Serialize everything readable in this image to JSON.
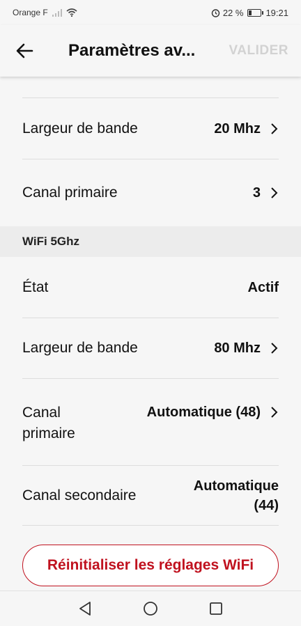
{
  "status": {
    "carrier": "Orange F",
    "battery": "22 %",
    "time": "19:21"
  },
  "app_bar": {
    "title": "Paramètres av...",
    "validate_label": "VALIDER"
  },
  "rows_top": [
    {
      "label": "Largeur de bande",
      "value": "20 Mhz"
    },
    {
      "label": "Canal primaire",
      "value": "3"
    }
  ],
  "section_5ghz": {
    "title": "WiFi 5Ghz"
  },
  "rows_5ghz": [
    {
      "label": "État",
      "value": "Actif"
    },
    {
      "label": "Largeur de bande",
      "value": "80 Mhz"
    },
    {
      "label": "Canal primaire",
      "value": "Automatique (48)"
    },
    {
      "label": "Canal secondaire",
      "value": "Automatique (44)"
    }
  ],
  "reset_button": {
    "label": "Réinitialiser les réglages WiFi"
  },
  "colors": {
    "accent": "#c0121f",
    "disabled": "#d2d2d2",
    "background": "#f6f6f6"
  },
  "icons": [
    "back-arrow-icon",
    "chevron-right-icon",
    "nav-back-icon",
    "nav-home-icon",
    "nav-recents-icon",
    "alarm-icon",
    "wifi-icon",
    "signal-icon",
    "battery-icon"
  ]
}
